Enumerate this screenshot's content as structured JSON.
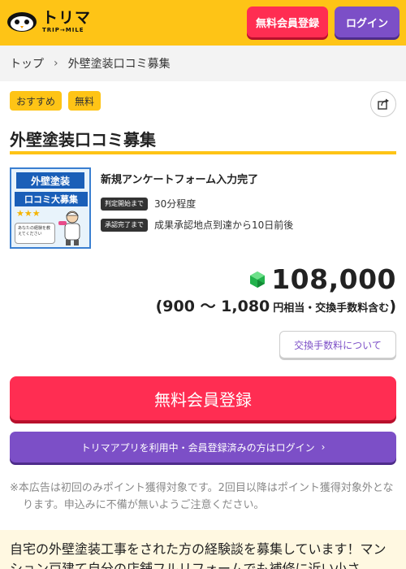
{
  "header": {
    "logo_main": "トリマ",
    "logo_sub": "TRIP→MILE",
    "register_label": "無料会員登録",
    "login_label": "ログイン"
  },
  "breadcrumb": {
    "home": "トップ",
    "current": "外壁塗装口コミ募集"
  },
  "tags": [
    "おすすめ",
    "無料"
  ],
  "page_title": "外壁塗装口コミ募集",
  "thumbnail": {
    "line1": "外壁塗装",
    "line2": "口コミ大募集",
    "stars": "★★★",
    "note": "あなたの経験を教えてください"
  },
  "offer": {
    "name": "新規アンケートフォーム入力完了",
    "conditions": [
      {
        "badge": "判定開始まで",
        "text": "30分程度"
      },
      {
        "badge": "承認完了まで",
        "text": "成果承認地点到達から10日前後"
      }
    ]
  },
  "points": {
    "value": "108,000",
    "yen_range": "(900 〜 1,080",
    "yen_suffix": "円相当・交換手数料含む",
    "close_paren": ")"
  },
  "fee_button": "交換手数料について",
  "cta": {
    "register": "無料会員登録",
    "login": "トリマアプリを利用中・会員登録済みの方はログイン"
  },
  "notice": "※本広告は初回のみポイント獲得対象です。2回目以降はポイント獲得対象外となります。申込みに不備が無いようご注意ください。",
  "description": "自宅の外壁塗装工事をされた方の経験談を募集しています！マンション戸建て自分の店舗フルリフォームでも補修に近い小さ",
  "colors": {
    "brand_yellow": "#fec416",
    "register_red": "#ff2d52",
    "login_purple": "#7c4fc7"
  }
}
